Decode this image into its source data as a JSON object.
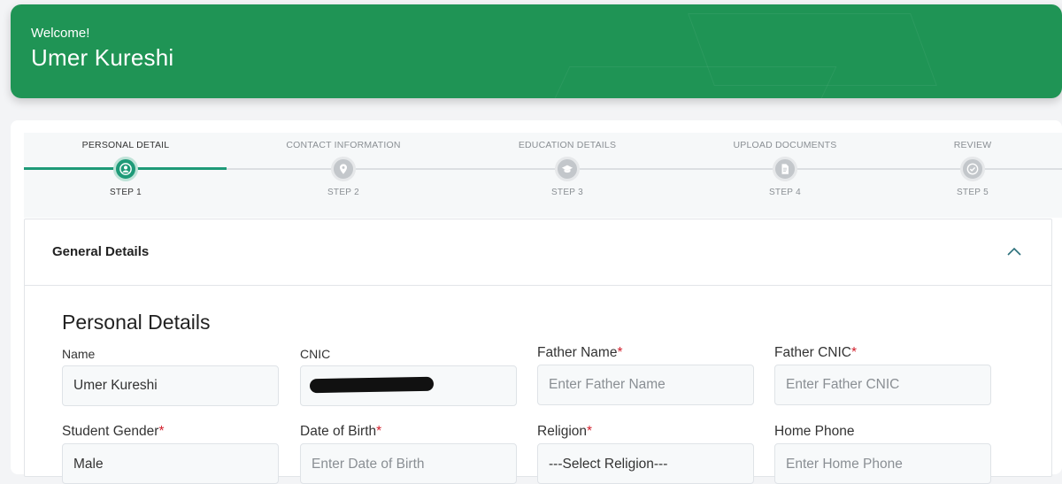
{
  "header": {
    "greeting": "Welcome!",
    "user_name": "Umer Kureshi"
  },
  "stepper": {
    "steps": [
      {
        "title": "PERSONAL DETAIL",
        "label": "STEP 1",
        "icon": "user-icon",
        "active": true
      },
      {
        "title": "CONTACT INFORMATION",
        "label": "STEP 2",
        "icon": "location-pin-icon",
        "active": false
      },
      {
        "title": "EDUCATION DETAILS",
        "label": "STEP 3",
        "icon": "graduation-cap-icon",
        "active": false
      },
      {
        "title": "UPLOAD DOCUMENTS",
        "label": "STEP 4",
        "icon": "document-icon",
        "active": false
      },
      {
        "title": "REVIEW",
        "label": "STEP 5",
        "icon": "check-circle-icon",
        "active": false
      }
    ]
  },
  "accordion": {
    "title": "General Details",
    "expanded": true
  },
  "form": {
    "section_title": "Personal Details",
    "fields": {
      "name": {
        "label": "Name",
        "value": "Umer Kureshi",
        "placeholder": ""
      },
      "cnic": {
        "label": "CNIC",
        "value": "",
        "placeholder": ""
      },
      "father_name": {
        "label": "Father Name",
        "required_mark": "*",
        "value": "",
        "placeholder": "Enter Father Name"
      },
      "father_cnic": {
        "label": "Father CNIC",
        "required_mark": "*",
        "value": "",
        "placeholder": "Enter Father CNIC"
      },
      "gender": {
        "label": "Student Gender",
        "required_mark": "*",
        "value": "Male"
      },
      "dob": {
        "label": "Date of Birth",
        "required_mark": "*",
        "value": "",
        "placeholder": "Enter Date of Birth"
      },
      "religion": {
        "label": "Religion",
        "required_mark": "*",
        "value": "---Select Religion---"
      },
      "home_phone": {
        "label": "Home Phone",
        "value": "",
        "placeholder": "Enter Home Phone"
      }
    }
  },
  "colors": {
    "brand_green": "#1f9455",
    "step_active": "#1e9a78",
    "required_red": "#d21f2c"
  }
}
